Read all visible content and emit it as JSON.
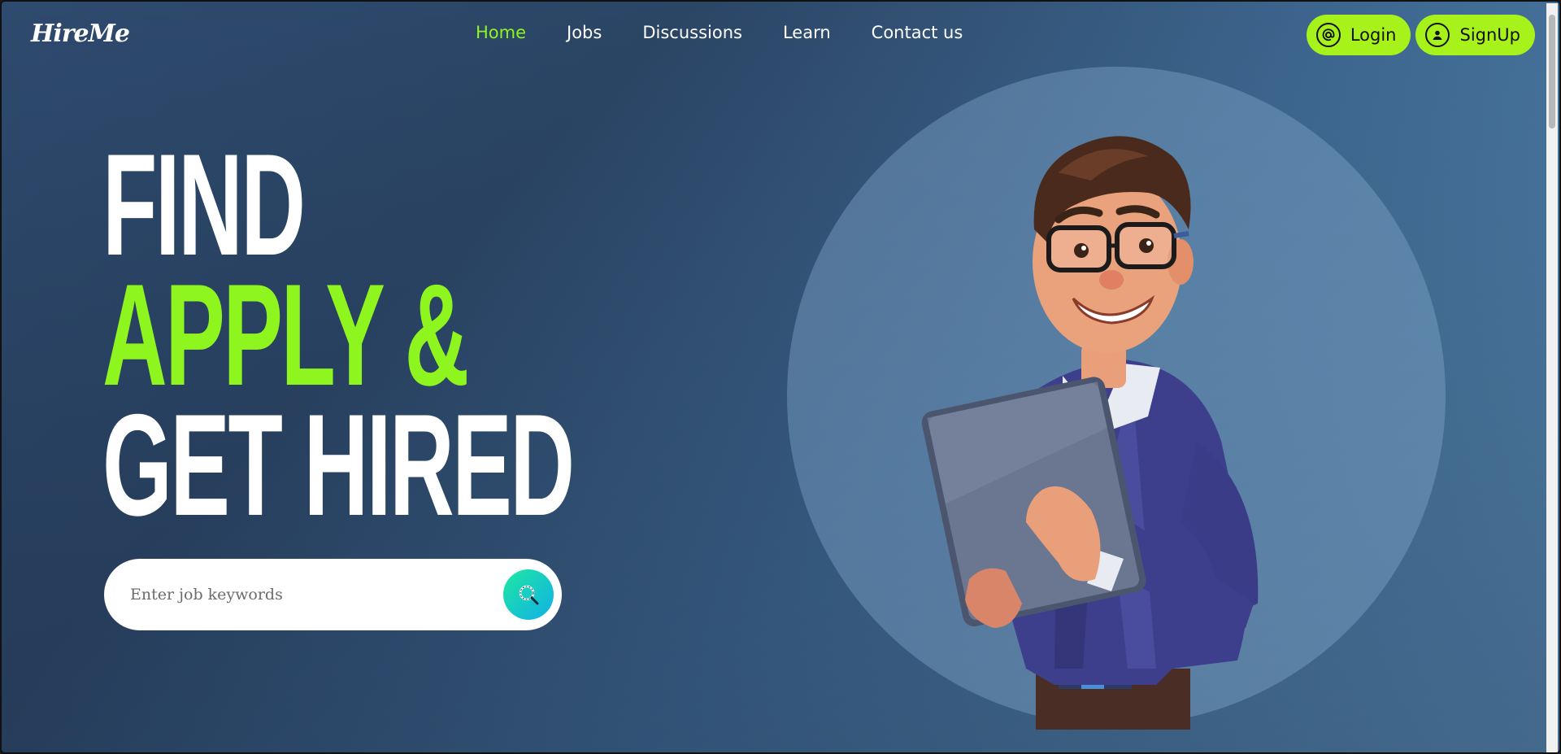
{
  "brand": {
    "logo_text": "HireMe"
  },
  "nav": {
    "items": [
      {
        "label": "Home",
        "active": true
      },
      {
        "label": "Jobs",
        "active": false
      },
      {
        "label": "Discussions",
        "active": false
      },
      {
        "label": "Learn",
        "active": false
      },
      {
        "label": "Contact us",
        "active": false
      }
    ]
  },
  "auth": {
    "login_label": "Login",
    "signup_label": "SignUp",
    "login_icon": "at-circle-icon",
    "signup_icon": "user-circle-icon"
  },
  "hero": {
    "line1": "FIND",
    "line2": "APPLY &",
    "line3": "GET HIRED"
  },
  "search": {
    "placeholder": "Enter job keywords",
    "value": "",
    "button_icon": "search-icon"
  },
  "colors": {
    "accent": "#8ef51f",
    "button_bg": "#a8f21c",
    "background_dark": "#2b4565",
    "background_light": "#5a8db5"
  }
}
